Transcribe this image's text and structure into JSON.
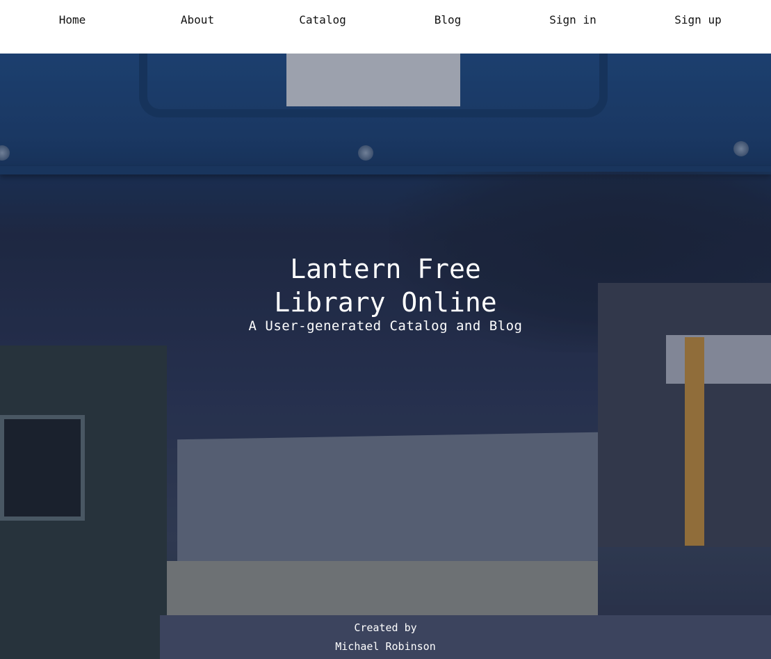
{
  "nav": {
    "items": [
      {
        "label": "Home"
      },
      {
        "label": "About"
      },
      {
        "label": "Catalog"
      },
      {
        "label": "Blog"
      },
      {
        "label": "Sign in"
      },
      {
        "label": "Sign up"
      }
    ]
  },
  "hero": {
    "title_line1": "Lantern Free",
    "title_line2": "Library Online",
    "subtitle": "A User-generated Catalog and Blog",
    "credit_label": "Created by",
    "credit_name": "Michael Robinson"
  },
  "colors": {
    "navbar_bg": "#ffffff",
    "nav_text": "#111111",
    "hero_text": "#ffffff"
  }
}
